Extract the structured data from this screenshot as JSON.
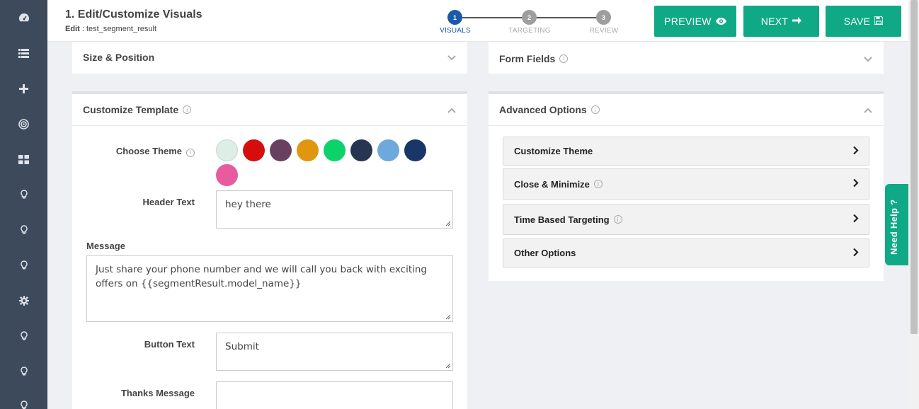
{
  "sidebar": {
    "items": [
      {
        "icon": "dashboard-icon"
      },
      {
        "icon": "list-icon"
      },
      {
        "icon": "plus-icon"
      },
      {
        "icon": "target-icon"
      },
      {
        "icon": "grid-icon"
      },
      {
        "icon": "lightbulb-icon"
      },
      {
        "icon": "lightbulb-icon"
      },
      {
        "icon": "lightbulb-icon"
      },
      {
        "icon": "gear-icon"
      },
      {
        "icon": "lightbulb-icon"
      },
      {
        "icon": "lightbulb-icon"
      },
      {
        "icon": "lightbulb-icon"
      }
    ]
  },
  "header": {
    "title": "1. Edit/Customize Visuals",
    "sub_label": "Edit",
    "sub_value": " : test_segment_result"
  },
  "steps": [
    {
      "number": "1",
      "label": "VISUALS",
      "active": true
    },
    {
      "number": "2",
      "label": "TARGETING",
      "active": false
    },
    {
      "number": "3",
      "label": "REVIEW",
      "active": false
    }
  ],
  "buttons": {
    "preview": "PREVIEW",
    "next": "NEXT",
    "save": "SAVE"
  },
  "panels": {
    "size_position": "Size & Position",
    "form_fields": "Form Fields",
    "customize_template": "Customize Template",
    "advanced_options": "Advanced Options"
  },
  "form": {
    "choose_theme_label": "Choose Theme",
    "theme_colors": [
      "#ddeee6",
      "#d60d0d",
      "#6a4060",
      "#e0960f",
      "#0cd26a",
      "#283550",
      "#6fa8dc",
      "#1a3668",
      "#e85b9f"
    ],
    "header_text_label": "Header Text",
    "header_text_value": "hey there",
    "message_label": "Message",
    "message_value": "Just share your phone number and we will call you back with exciting offers on {{segmentResult.model_name}}",
    "button_text_label": "Button Text",
    "button_text_value": "Submit",
    "thanks_message_label": "Thanks Message",
    "thanks_message_value": ""
  },
  "advanced": {
    "items": [
      {
        "label": "Customize Theme",
        "info": false
      },
      {
        "label": "Close & Minimize",
        "info": true
      },
      {
        "label": "Time Based Targeting",
        "info": true
      },
      {
        "label": "Other Options",
        "info": false
      }
    ]
  },
  "help": {
    "label": "Need Help ?"
  },
  "colors": {
    "accent": "#10a985",
    "sidebar": "#3d4a5c",
    "step_active": "#1a5aa8",
    "step_inactive": "#9e9e9e"
  }
}
